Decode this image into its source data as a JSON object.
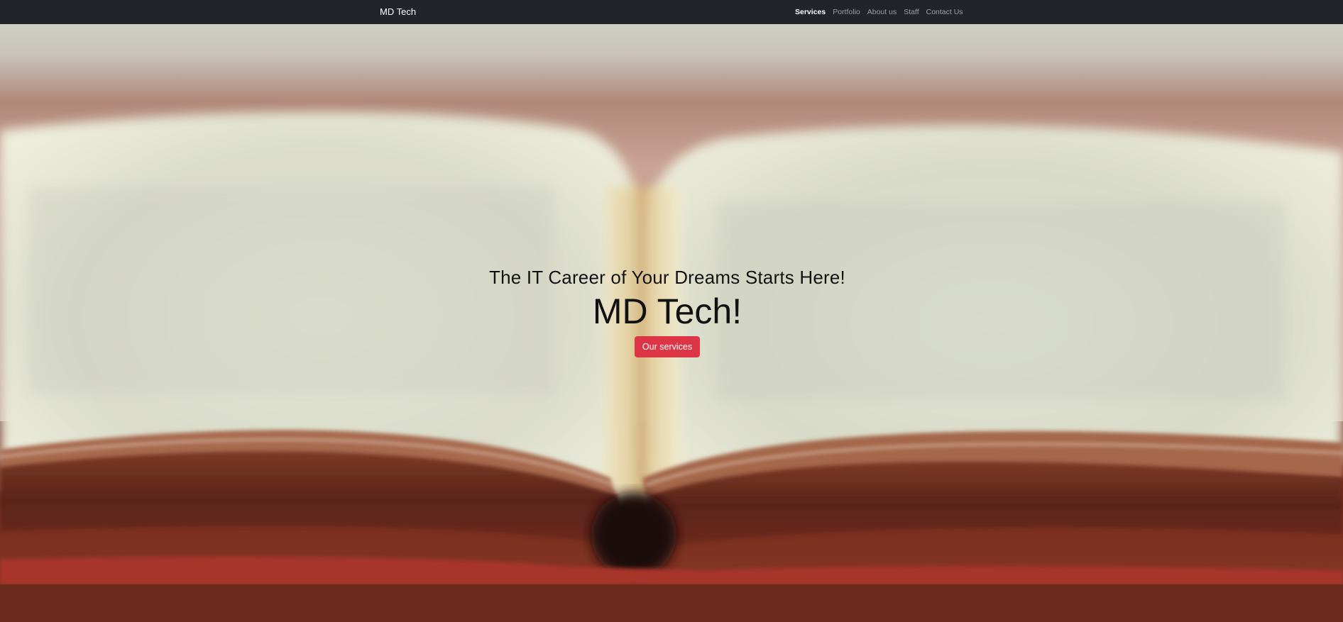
{
  "navbar": {
    "brand": "MD Tech",
    "links": [
      {
        "label": "Services",
        "active": true
      },
      {
        "label": "Portfolio",
        "active": false
      },
      {
        "label": "About us",
        "active": false
      },
      {
        "label": "Staff",
        "active": false
      },
      {
        "label": "Contact Us",
        "active": false
      }
    ]
  },
  "hero": {
    "subheading": "The IT Career of Your Dreams Starts Here!",
    "heading": "MD Tech!",
    "button_label": "Our services",
    "background_image": "open book on red wooden table",
    "button_color": "#dc3545",
    "nav_color": "#212529"
  }
}
